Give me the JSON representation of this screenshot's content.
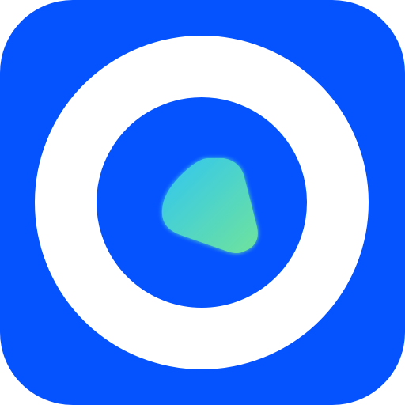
{
  "app_icon": {
    "icon": "ring-play-icon",
    "colors": {
      "tile": "#0552FF",
      "ring": "#FFFFFF",
      "gradient_start": "#30C6F2",
      "gradient_end": "#6FE39C"
    }
  }
}
